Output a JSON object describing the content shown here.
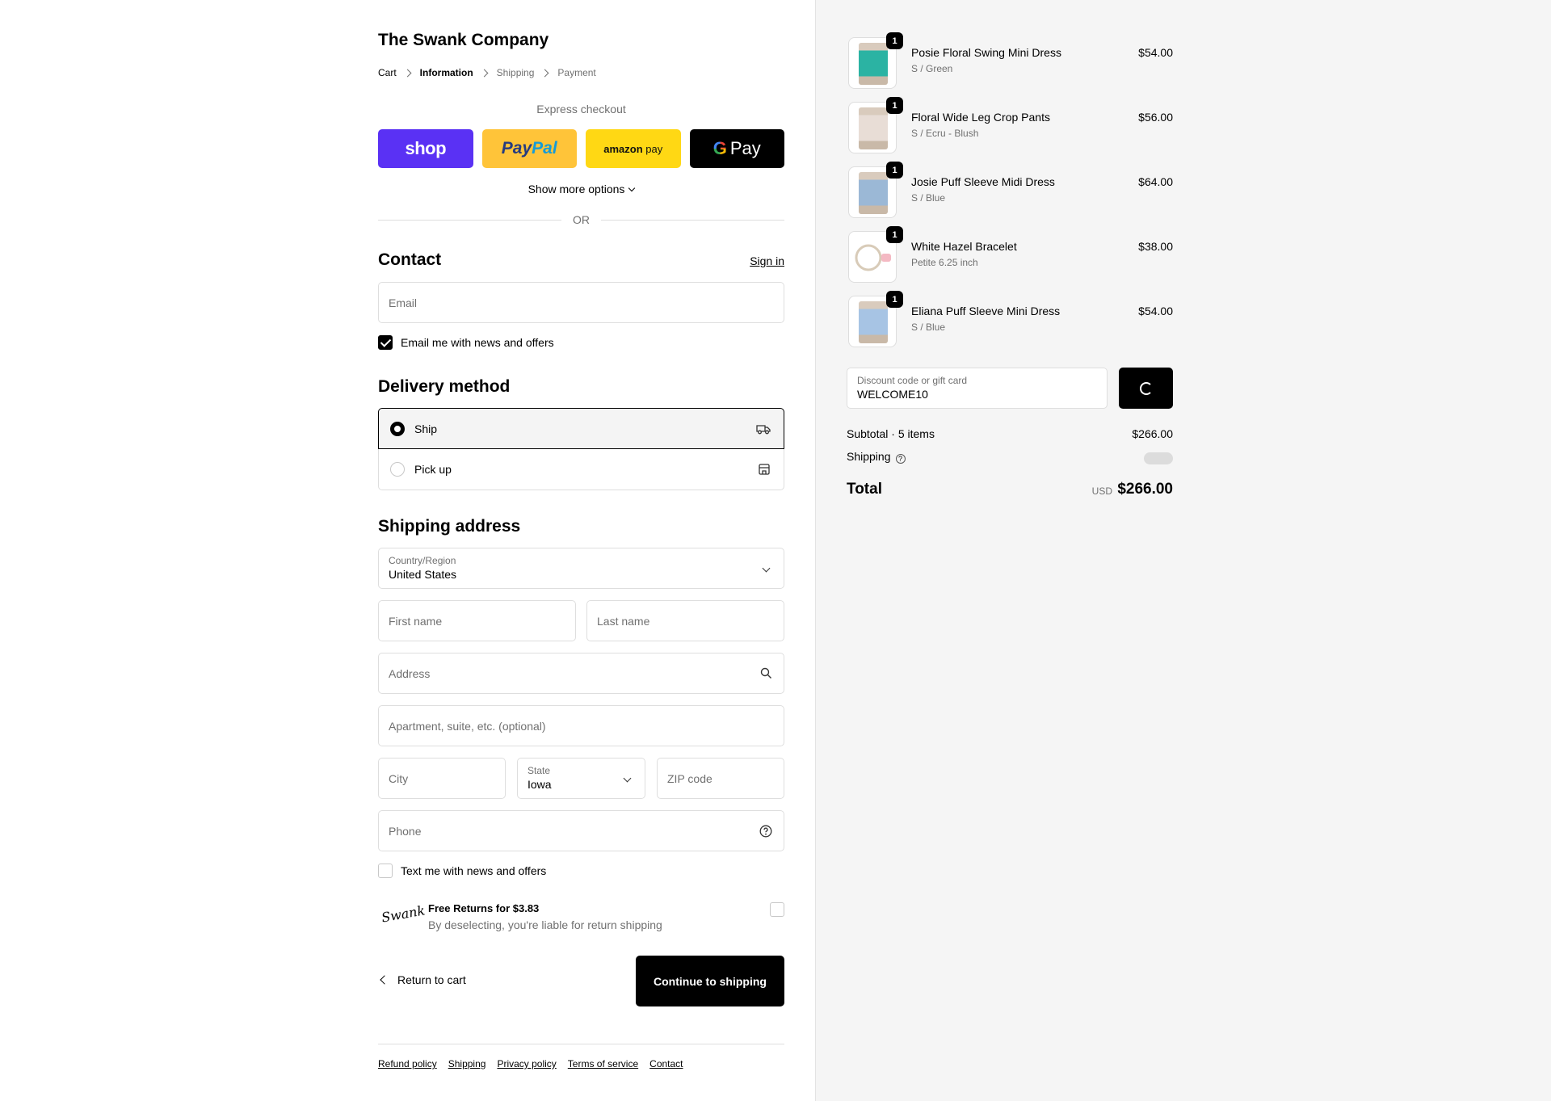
{
  "store": {
    "name": "The Swank Company"
  },
  "breadcrumb": [
    {
      "label": "Cart"
    },
    {
      "label": "Information"
    },
    {
      "label": "Shipping"
    },
    {
      "label": "Payment"
    }
  ],
  "express": {
    "title": "Express checkout",
    "shop_label": "shop",
    "paypal_part1": "Pay",
    "paypal_part2": "Pal",
    "amazon_part1": "amazon",
    "amazon_part2": "pay",
    "gpay_g": "G",
    "gpay_label": "Pay",
    "more_options": "Show more options",
    "or_label": "OR"
  },
  "contact": {
    "title": "Contact",
    "signin": "Sign in",
    "email_placeholder": "Email",
    "news_label": "Email me with news and offers",
    "news_checked": true
  },
  "delivery": {
    "title": "Delivery method",
    "ship_label": "Ship",
    "pickup_label": "Pick up",
    "selected": "ship"
  },
  "shipping": {
    "title": "Shipping address",
    "country_label": "Country/Region",
    "country_value": "United States",
    "first_name_placeholder": "First name",
    "last_name_placeholder": "Last name",
    "address_placeholder": "Address",
    "apartment_placeholder": "Apartment, suite, etc. (optional)",
    "city_placeholder": "City",
    "state_label": "State",
    "state_value": "Iowa",
    "zip_placeholder": "ZIP code",
    "phone_placeholder": "Phone",
    "text_label": "Text me with news and offers",
    "text_checked": false
  },
  "returns": {
    "logo_text": "Swank",
    "title": "Free Returns for $3.83",
    "subtitle": "By deselecting, you're liable for return shipping",
    "checked": false
  },
  "actions": {
    "return_to_cart": "Return to cart",
    "continue": "Continue to shipping"
  },
  "footer_links": [
    "Refund policy",
    "Shipping",
    "Privacy policy",
    "Terms of service",
    "Contact"
  ],
  "order": {
    "items": [
      {
        "name": "Posie Floral Swing Mini Dress",
        "variant": "S / Green",
        "price": "$54.00",
        "qty": "1",
        "swatch": "#2bb3a3"
      },
      {
        "name": "Floral Wide Leg Crop Pants",
        "variant": "S / Ecru - Blush",
        "price": "$56.00",
        "qty": "1",
        "swatch": "#e8ddd6"
      },
      {
        "name": "Josie Puff Sleeve Midi Dress",
        "variant": "S / Blue",
        "price": "$64.00",
        "qty": "1",
        "swatch": "#9bb8d6"
      },
      {
        "name": "White Hazel Bracelet",
        "variant": "Petite 6.25 inch",
        "price": "$38.00",
        "qty": "1",
        "swatch": "#f3ece4"
      },
      {
        "name": "Eliana Puff Sleeve Mini Dress",
        "variant": "S / Blue",
        "price": "$54.00",
        "qty": "1",
        "swatch": "#a7c4e4"
      }
    ],
    "discount_label": "Discount code or gift card",
    "discount_value": "WELCOME10",
    "subtotal_label": "Subtotal · 5 items",
    "subtotal_value": "$266.00",
    "shipping_label": "Shipping",
    "total_label": "Total",
    "currency": "USD",
    "total_value": "$266.00"
  },
  "colors": {
    "shop_pay": "#5a31f4",
    "paypal": "#ffc439",
    "amazon_pay": "#ffd814",
    "gpay": "#000000",
    "primary_button": "#000000"
  }
}
